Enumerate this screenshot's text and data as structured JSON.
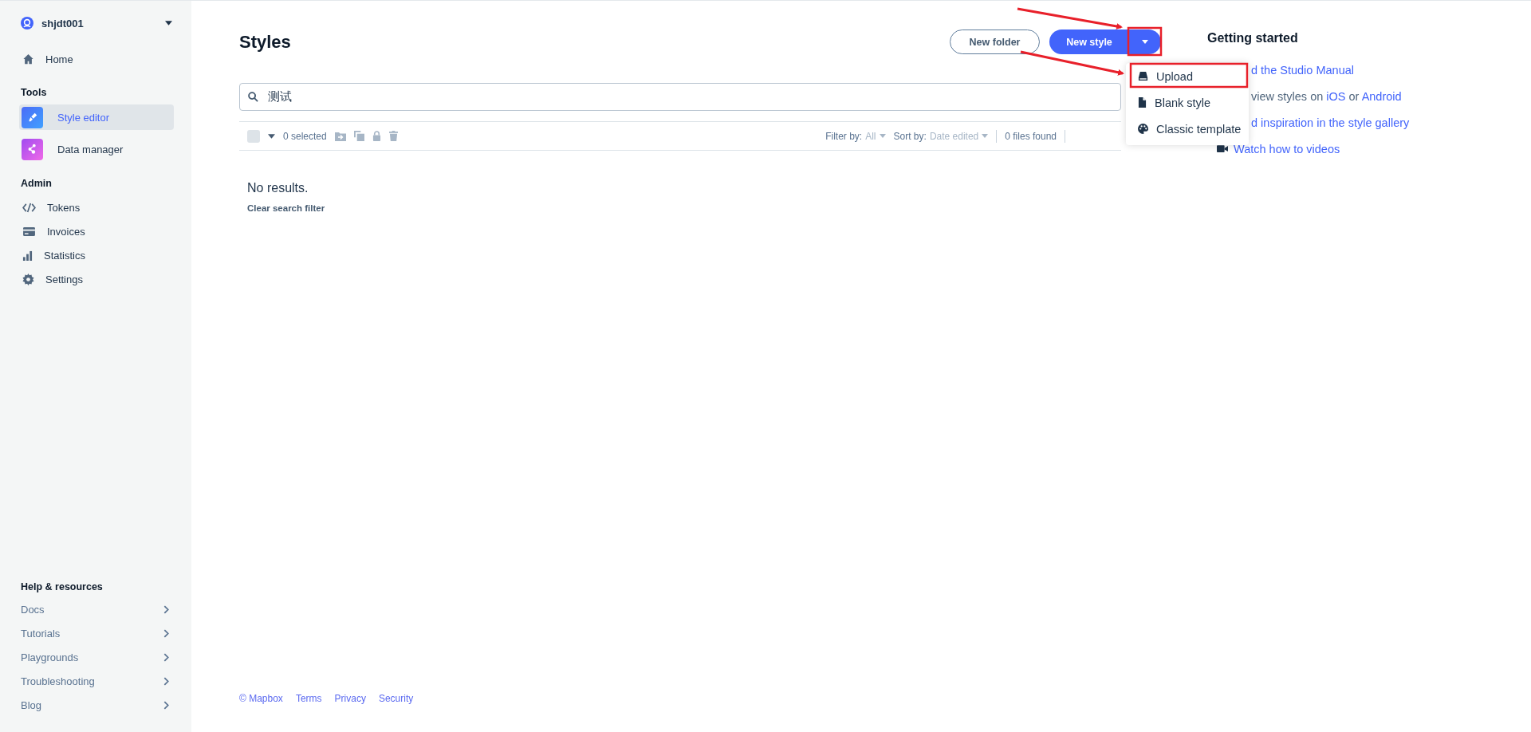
{
  "sidebar": {
    "account": "shjdt001",
    "sections": [
      {
        "kind": "plain",
        "items": [
          {
            "label": "Home",
            "selected": false
          }
        ]
      },
      {
        "kind": "tools",
        "title": "Tools",
        "items": [
          {
            "label": "Style editor",
            "selected": true
          },
          {
            "label": "Data manager",
            "selected": false
          }
        ]
      },
      {
        "kind": "plain",
        "title": "Admin",
        "items": [
          {
            "label": "Tokens",
            "selected": false
          },
          {
            "label": "Invoices",
            "selected": false
          },
          {
            "label": "Statistics",
            "selected": false
          },
          {
            "label": "Settings",
            "selected": false
          }
        ]
      }
    ],
    "help": {
      "title": "Help & resources",
      "items": [
        "Docs",
        "Tutorials",
        "Playgrounds",
        "Troubleshooting",
        "Blog"
      ]
    }
  },
  "main": {
    "title": "Styles",
    "buttons": [
      {
        "label": "New folder",
        "kind": "outline"
      },
      {
        "label": "New style",
        "kind": "primary"
      }
    ],
    "search": {
      "value": "测试"
    },
    "toolbar": {
      "select_all": {
        "checked": false
      },
      "selected_count": "0 selected",
      "filter": {
        "label": "Filter by:",
        "value": "All"
      },
      "sort": {
        "label": "Sort by:",
        "value": "Date edited"
      },
      "count": "0 files found"
    },
    "empty": {
      "message": "No results.",
      "action": "Clear search filter"
    },
    "footer": [
      "© Mapbox",
      "Terms",
      "Privacy",
      "Security"
    ]
  },
  "new_style_menu": {
    "items": [
      {
        "label": "Upload"
      },
      {
        "label": "Blank style"
      },
      {
        "label": "Classic template"
      }
    ]
  },
  "getting_started": {
    "title": "Getting started",
    "links": [
      {
        "parts": [
          {
            "text": "d the Studio Manual",
            "link": true
          }
        ]
      },
      {
        "parts": [
          {
            "text": "view styles on ",
            "link": false
          },
          {
            "text": "iOS",
            "link": true
          },
          {
            "text": " or ",
            "link": false
          },
          {
            "text": "Android",
            "link": true
          }
        ]
      },
      {
        "parts": [
          {
            "text": "d inspiration in the style gallery",
            "link": true
          }
        ]
      },
      {
        "parts": [
          {
            "text": "Watch how to videos",
            "link": true
          }
        ]
      }
    ]
  }
}
